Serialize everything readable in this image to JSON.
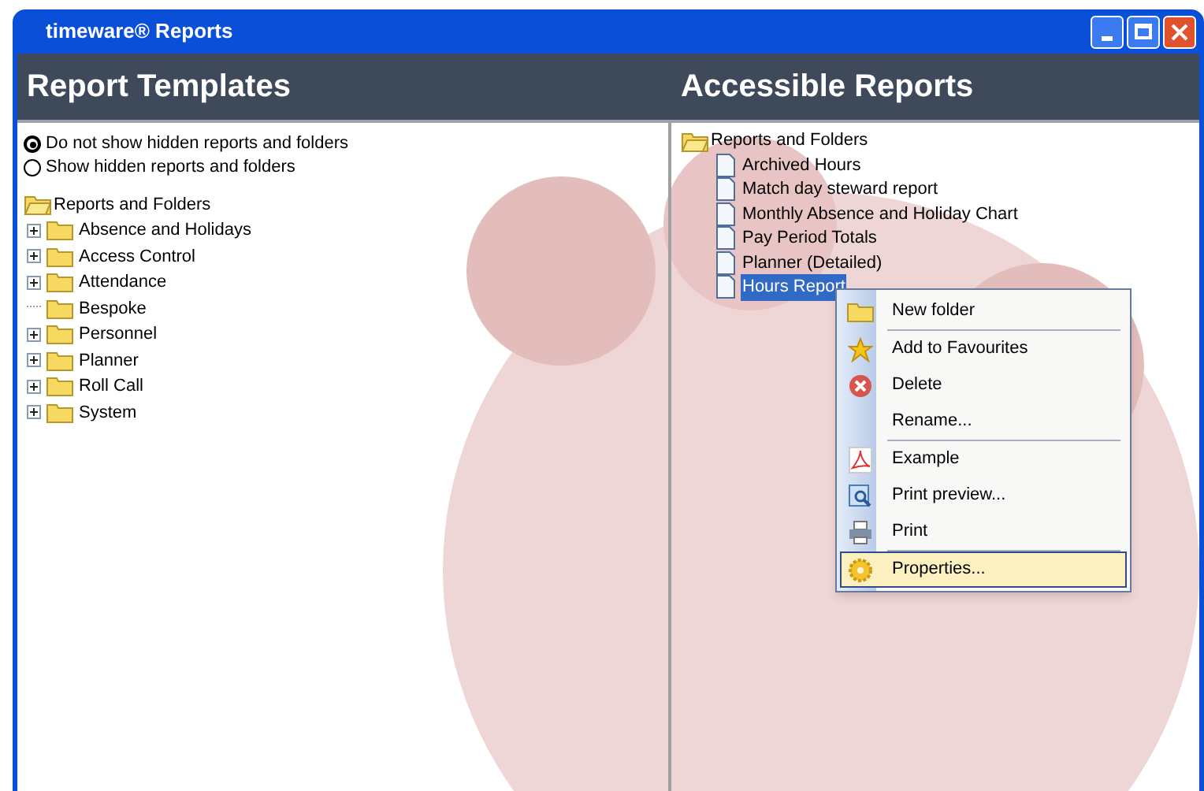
{
  "window": {
    "title": "timeware® Reports"
  },
  "templates": {
    "heading": "Report Templates",
    "options": [
      {
        "label": "Do not show hidden reports and folders",
        "selected": true
      },
      {
        "label": "Show hidden reports and folders",
        "selected": false
      }
    ],
    "tree": {
      "label": "Reports and Folders",
      "expanded": true,
      "children": [
        {
          "label": "Absence and Holidays",
          "expandable": true
        },
        {
          "label": "Access Control",
          "expandable": true
        },
        {
          "label": "Attendance",
          "expandable": true
        },
        {
          "label": "Bespoke",
          "expandable": false
        },
        {
          "label": "Personnel",
          "expandable": true
        },
        {
          "label": "Planner",
          "expandable": true
        },
        {
          "label": "Roll Call",
          "expandable": true
        },
        {
          "label": "System",
          "expandable": true
        }
      ]
    }
  },
  "accessible": {
    "heading": "Accessible Reports",
    "tree": {
      "label": "Reports and Folders",
      "expanded": true,
      "children": [
        {
          "label": "Archived Hours",
          "selected": false
        },
        {
          "label": "Match day steward report",
          "selected": false
        },
        {
          "label": "Monthly Absence and Holiday Chart",
          "selected": false
        },
        {
          "label": "Pay Period Totals",
          "selected": false
        },
        {
          "label": "Planner (Detailed)",
          "selected": false
        },
        {
          "label": "Hours Report",
          "selected": true
        }
      ]
    }
  },
  "context_menu": {
    "groups": [
      {
        "items": [
          {
            "label": "New folder",
            "kind": "folder",
            "selected": false
          }
        ]
      },
      {
        "items": [
          {
            "label": "Add to Favourites",
            "kind": "star",
            "selected": false
          },
          {
            "label": "Delete",
            "kind": "delete",
            "selected": false
          },
          {
            "label": "Rename...",
            "kind": "plain",
            "selected": false
          }
        ]
      },
      {
        "items": [
          {
            "label": "Example",
            "kind": "pdf",
            "selected": false
          },
          {
            "label": "Print preview...",
            "kind": "preview",
            "selected": false
          },
          {
            "label": "Print",
            "kind": "printer",
            "selected": false
          }
        ]
      },
      {
        "items": [
          {
            "label": "Properties...",
            "kind": "gear",
            "selected": true
          }
        ]
      }
    ]
  }
}
